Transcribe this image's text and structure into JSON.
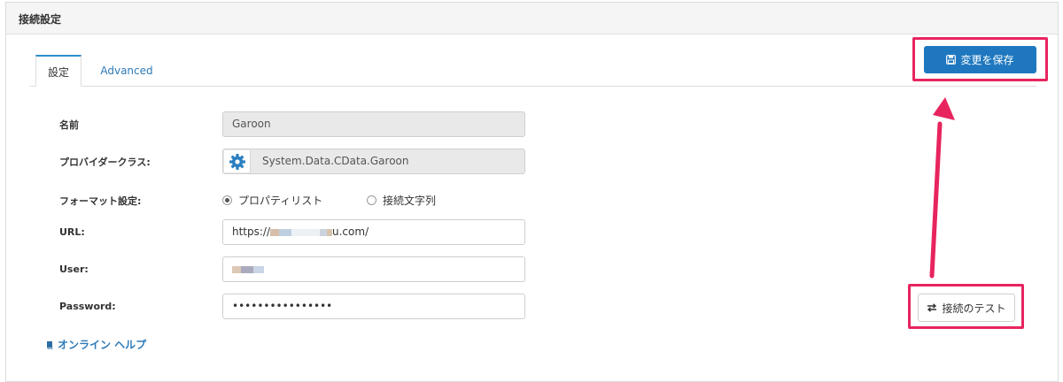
{
  "panel": {
    "title": "接続設定"
  },
  "tabs": [
    {
      "label": "設定",
      "active": true
    },
    {
      "label": "Advanced",
      "active": false
    }
  ],
  "form": {
    "name": {
      "label": "名前",
      "value": "Garoon"
    },
    "provider": {
      "label": "プロバイダークラス:",
      "value": "System.Data.CData.Garoon",
      "icon": "gear-icon"
    },
    "format": {
      "label": "フォーマット設定:",
      "options": [
        {
          "label": "プロパティリスト",
          "selected": true
        },
        {
          "label": "接続文字列",
          "selected": false
        }
      ]
    },
    "url": {
      "label": "URL:",
      "value_start": "https://",
      "value_end": "u.com/"
    },
    "user": {
      "label": "User:"
    },
    "password": {
      "label": "Password:",
      "value": "••••••••••••••••"
    }
  },
  "help": {
    "label": "オンライン ヘルプ",
    "icon": "book-icon"
  },
  "buttons": {
    "save": {
      "label": "変更を保存",
      "icon": "floppy-disk-icon"
    },
    "test": {
      "label": "接続のテスト",
      "icon": "exchange-arrows-icon"
    }
  },
  "colors": {
    "primary": "#1f78bf",
    "highlight": "#e8245e",
    "link": "#2e7ab8"
  }
}
